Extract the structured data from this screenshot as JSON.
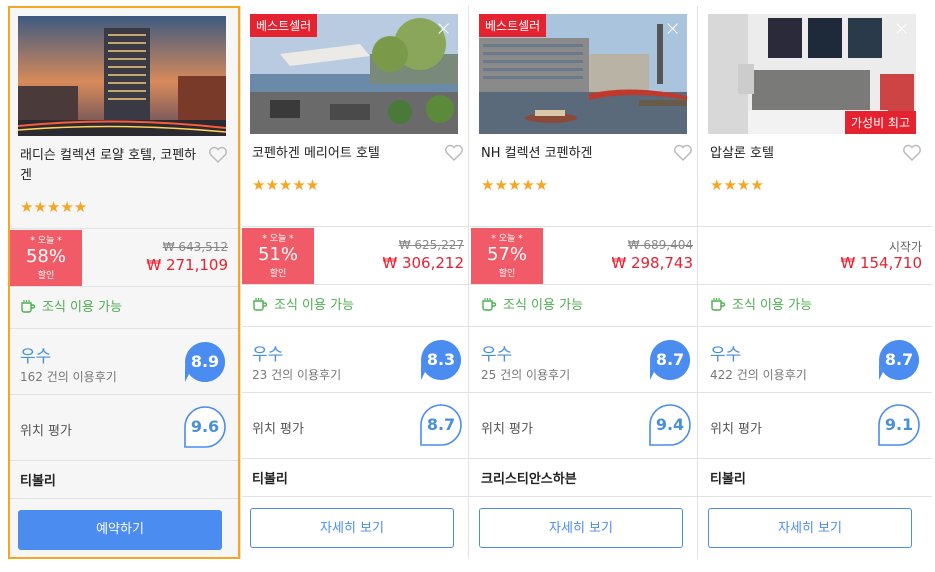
{
  "hotels": [
    {
      "name": "래디슨 컬렉션 로얄 호텔, 코펜하겐",
      "stars": "★★★★★",
      "deal_top": "* 오늘 *",
      "deal_pct": "58%",
      "deal_sub": "할인",
      "price_old": "₩ 643,512",
      "price_new": "₩ 271,109",
      "breakfast": "조식 이용 가능",
      "rating_label": "우수",
      "reviews": "162 건의 이용후기",
      "score": "8.9",
      "location_label": "위치 평가",
      "location_score": "9.6",
      "district": "티볼리",
      "button": "예약하기"
    },
    {
      "name": "코펜하겐 메리어트 호텔",
      "badge": "베스트셀러",
      "stars": "★★★★★",
      "deal_top": "* 오늘 *",
      "deal_pct": "51%",
      "deal_sub": "할인",
      "price_old": "₩ 625,227",
      "price_new": "₩ 306,212",
      "breakfast": "조식 이용 가능",
      "rating_label": "우수",
      "reviews": "23 건의 이용후기",
      "score": "8.3",
      "location_label": "위치 평가",
      "location_score": "8.7",
      "district": "티볼리",
      "button": "자세히 보기"
    },
    {
      "name": "NH 컬렉션 코펜하겐",
      "badge": "베스트셀러",
      "stars": "★★★★★",
      "deal_top": "* 오늘 *",
      "deal_pct": "57%",
      "deal_sub": "할인",
      "price_old": "₩ 689,404",
      "price_new": "₩ 298,743",
      "breakfast": "조식 이용 가능",
      "rating_label": "우수",
      "reviews": "25 건의 이용후기",
      "score": "8.7",
      "location_label": "위치 평가",
      "location_score": "9.4",
      "district": "크리스티안스하븐",
      "button": "자세히 보기"
    },
    {
      "name": "압살론 호텔",
      "badge": "가성비 최고",
      "stars": "★★★★",
      "price_from": "시작가",
      "price_new": "₩ 154,710",
      "breakfast": "조식 이용 가능",
      "rating_label": "우수",
      "reviews": "422 건의 이용후기",
      "score": "8.7",
      "location_label": "위치 평가",
      "location_score": "9.1",
      "district": "티볼리",
      "button": "자세히 보기"
    }
  ],
  "icons": {
    "close": "×",
    "heart": "heart-outline-icon",
    "cup": "coffee-cup-icon"
  },
  "colors": {
    "accent": "#4a8cf0",
    "deal": "#f05b67",
    "price": "#e52330",
    "star": "#f5a623",
    "breakfast": "#4caf50",
    "selected_border": "#f5a623"
  }
}
